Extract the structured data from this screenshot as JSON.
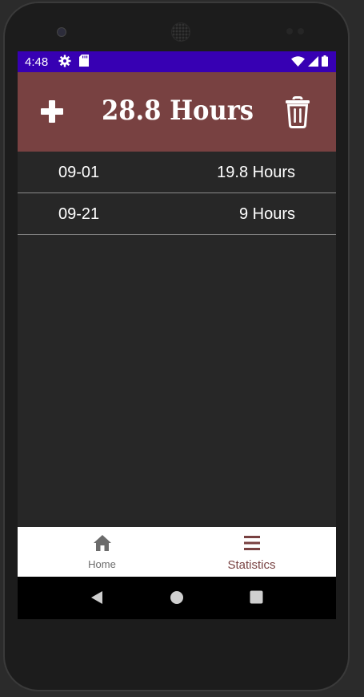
{
  "status_bar": {
    "time": "4:48",
    "left_icons": [
      "gear-icon",
      "sd-card-icon"
    ],
    "right_icons": [
      "wifi-icon",
      "signal-icon",
      "battery-icon"
    ],
    "color": "#3700b3"
  },
  "app_bar": {
    "total": "28.8 Hours",
    "add_icon": "plus-icon",
    "delete_icon": "trash-icon",
    "color": "#784141"
  },
  "entries": [
    {
      "date": "09-01",
      "hours": "19.8 Hours"
    },
    {
      "date": "09-21",
      "hours": "9 Hours"
    }
  ],
  "bottom_nav": {
    "items": [
      {
        "label": "Home",
        "icon": "home-icon",
        "active": false
      },
      {
        "label": "Statistics",
        "icon": "menu-icon",
        "active": true
      }
    ],
    "active_color": "#784141",
    "inactive_color": "#6b6b6b"
  },
  "system_nav": {
    "buttons": [
      "back-icon",
      "home-circle-icon",
      "recents-icon"
    ]
  }
}
